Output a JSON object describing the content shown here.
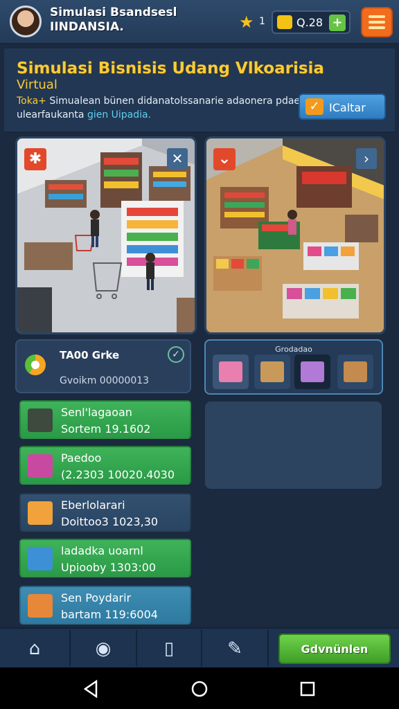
{
  "header": {
    "app_title": "Simulasi Bsandsesl\nIINDANSIA.",
    "stars": "1",
    "coins": "Q.28",
    "coin_add": "+"
  },
  "banner": {
    "title": "Simulasi Bisnisis Udang Vlkoarisia",
    "subtitle": "Virtual",
    "desc_tag": "Toka+",
    "desc_text": " Simualean bünen didanatolssanarie adaonera pdae ulearfaukanta ",
    "desc_highlight": "gien Uipadia.",
    "calc_label": "ICaltar"
  },
  "product": {
    "name": "TA00 Grke",
    "meta": "Gvoikm 00000013"
  },
  "inventory": {
    "title": "Grodadao"
  },
  "actions": [
    {
      "label": "Senl'lagaoan",
      "value": "Sortem 19.1602"
    },
    {
      "label": "Paedoo",
      "value": "(2.2303 10020.4030"
    },
    {
      "label": "Eberlolarari",
      "value": "Doittoo3 1023,30"
    },
    {
      "label": "ladadka uoarnl",
      "value": "Upiooby 1303:00"
    },
    {
      "label": "Sen Poydarir",
      "value": "bartam 119:6004"
    }
  ],
  "navbar": {
    "cta_label": "Gdvnünlen"
  },
  "colors": {
    "accent_gold": "#f7cc38",
    "button_green": "#3fb35a",
    "menu_orange": "#f26c1e",
    "background": "#1b2a3f"
  },
  "icons": [
    "star-icon",
    "coin-icon",
    "menu-icon",
    "home-icon",
    "location-icon",
    "bottle-icon",
    "tools-icon"
  ]
}
